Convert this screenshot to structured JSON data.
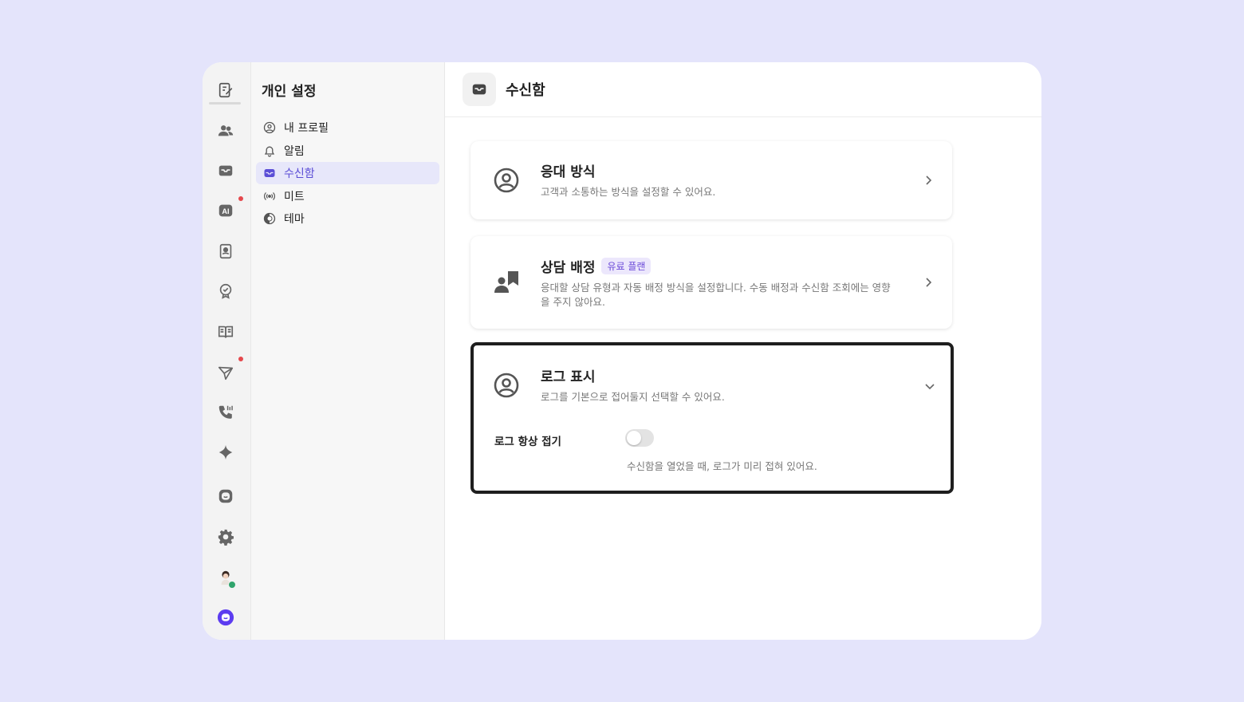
{
  "settings_panel": {
    "title": "개인 설정",
    "items": [
      {
        "label": "내 프로필",
        "icon": "profile-icon"
      },
      {
        "label": "알림",
        "icon": "bell-icon"
      },
      {
        "label": "수신함",
        "icon": "inbox-icon",
        "active": true
      },
      {
        "label": "미트",
        "icon": "broadcast-icon"
      },
      {
        "label": "테마",
        "icon": "theme-icon"
      }
    ]
  },
  "header": {
    "title": "수신함",
    "icon": "inbox-icon"
  },
  "cards": [
    {
      "title": "응대 방식",
      "description": "고객과 소통하는 방식을 설정할 수 있어요.",
      "icon": "user-circle-icon"
    },
    {
      "title": "상담 배정",
      "badge": "유료 플랜",
      "description": "응대할 상담 유형과 자동 배정 방식을 설정합니다. 수동 배정과 수신함 조회에는 영향을 주지 않아요.",
      "icon": "assign-icon"
    },
    {
      "title": "로그 표시",
      "description": "로그를 기본으로 접어둘지 선택할 수 있어요.",
      "icon": "user-circle-icon",
      "setting": {
        "label": "로그 항상 접기",
        "help": "수신함을 열었을 때, 로그가 미리 접혀 있어요.",
        "enabled": false
      }
    }
  ],
  "colors": {
    "accent": "#5b4ed6",
    "background": "#e4e4fb",
    "notification_dot": "#e5484d",
    "online": "#30a46c"
  }
}
